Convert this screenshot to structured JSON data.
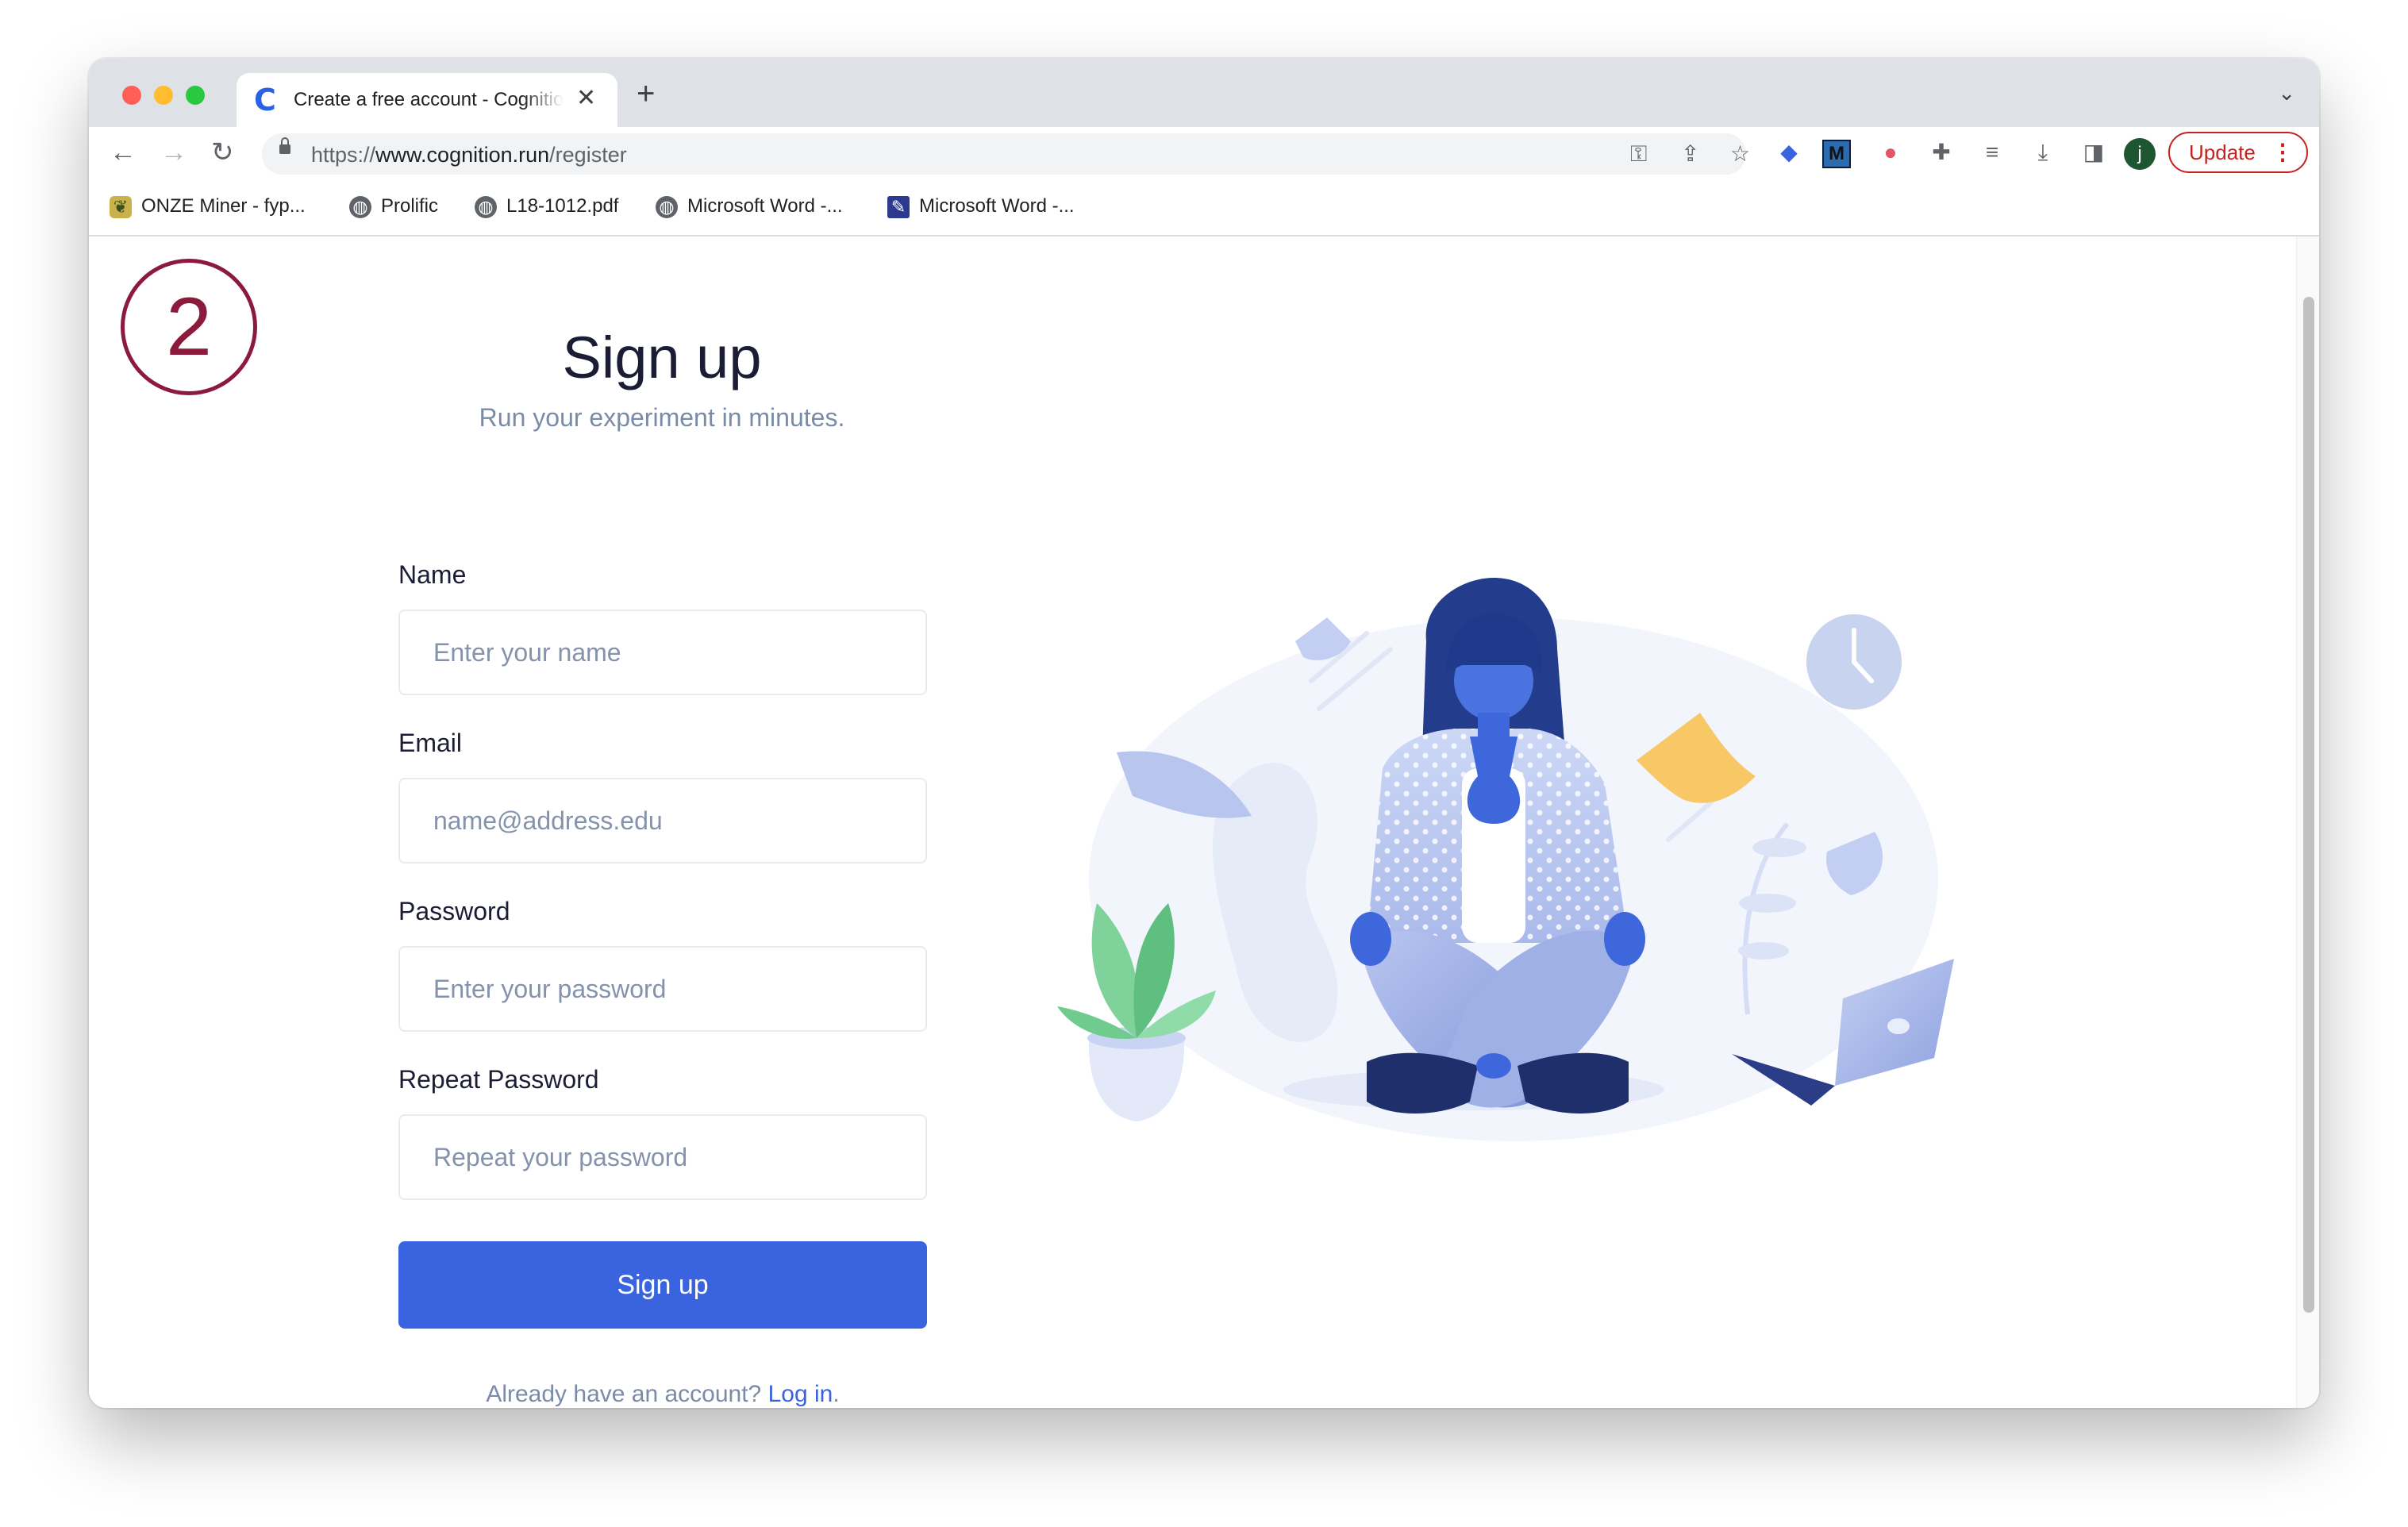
{
  "browser": {
    "tab": {
      "title": "Create a free account - Cognition",
      "favicon_letter": "C"
    },
    "new_tab_symbol": "+",
    "address": {
      "scheme": "https://",
      "host": "www.cognition.run",
      "path": "/register"
    },
    "profile_initial": "j",
    "extension_m_label": "M",
    "update_label": "Update",
    "bookmarks": [
      {
        "label": "ONZE Miner - fyp..."
      },
      {
        "label": "Prolific"
      },
      {
        "label": "L18-1012.pdf"
      },
      {
        "label": "Microsoft Word -..."
      },
      {
        "label": "Microsoft Word -..."
      }
    ]
  },
  "page": {
    "step_number": "2",
    "title": "Sign up",
    "subtitle": "Run your experiment in minutes.",
    "fields": [
      {
        "label": "Name",
        "placeholder": "Enter your name",
        "value": ""
      },
      {
        "label": "Email",
        "placeholder": "name@address.edu",
        "value": ""
      },
      {
        "label": "Password",
        "placeholder": "Enter your password",
        "value": ""
      },
      {
        "label": "Repeat Password",
        "placeholder": "Repeat your password",
        "value": ""
      }
    ],
    "submit_label": "Sign up",
    "login_prompt": "Already have an account?",
    "login_link": "Log in",
    "login_suffix": "."
  },
  "colors": {
    "accent": "#3a63e0",
    "step_circle": "#8b1a3d",
    "update": "#c5221f"
  }
}
